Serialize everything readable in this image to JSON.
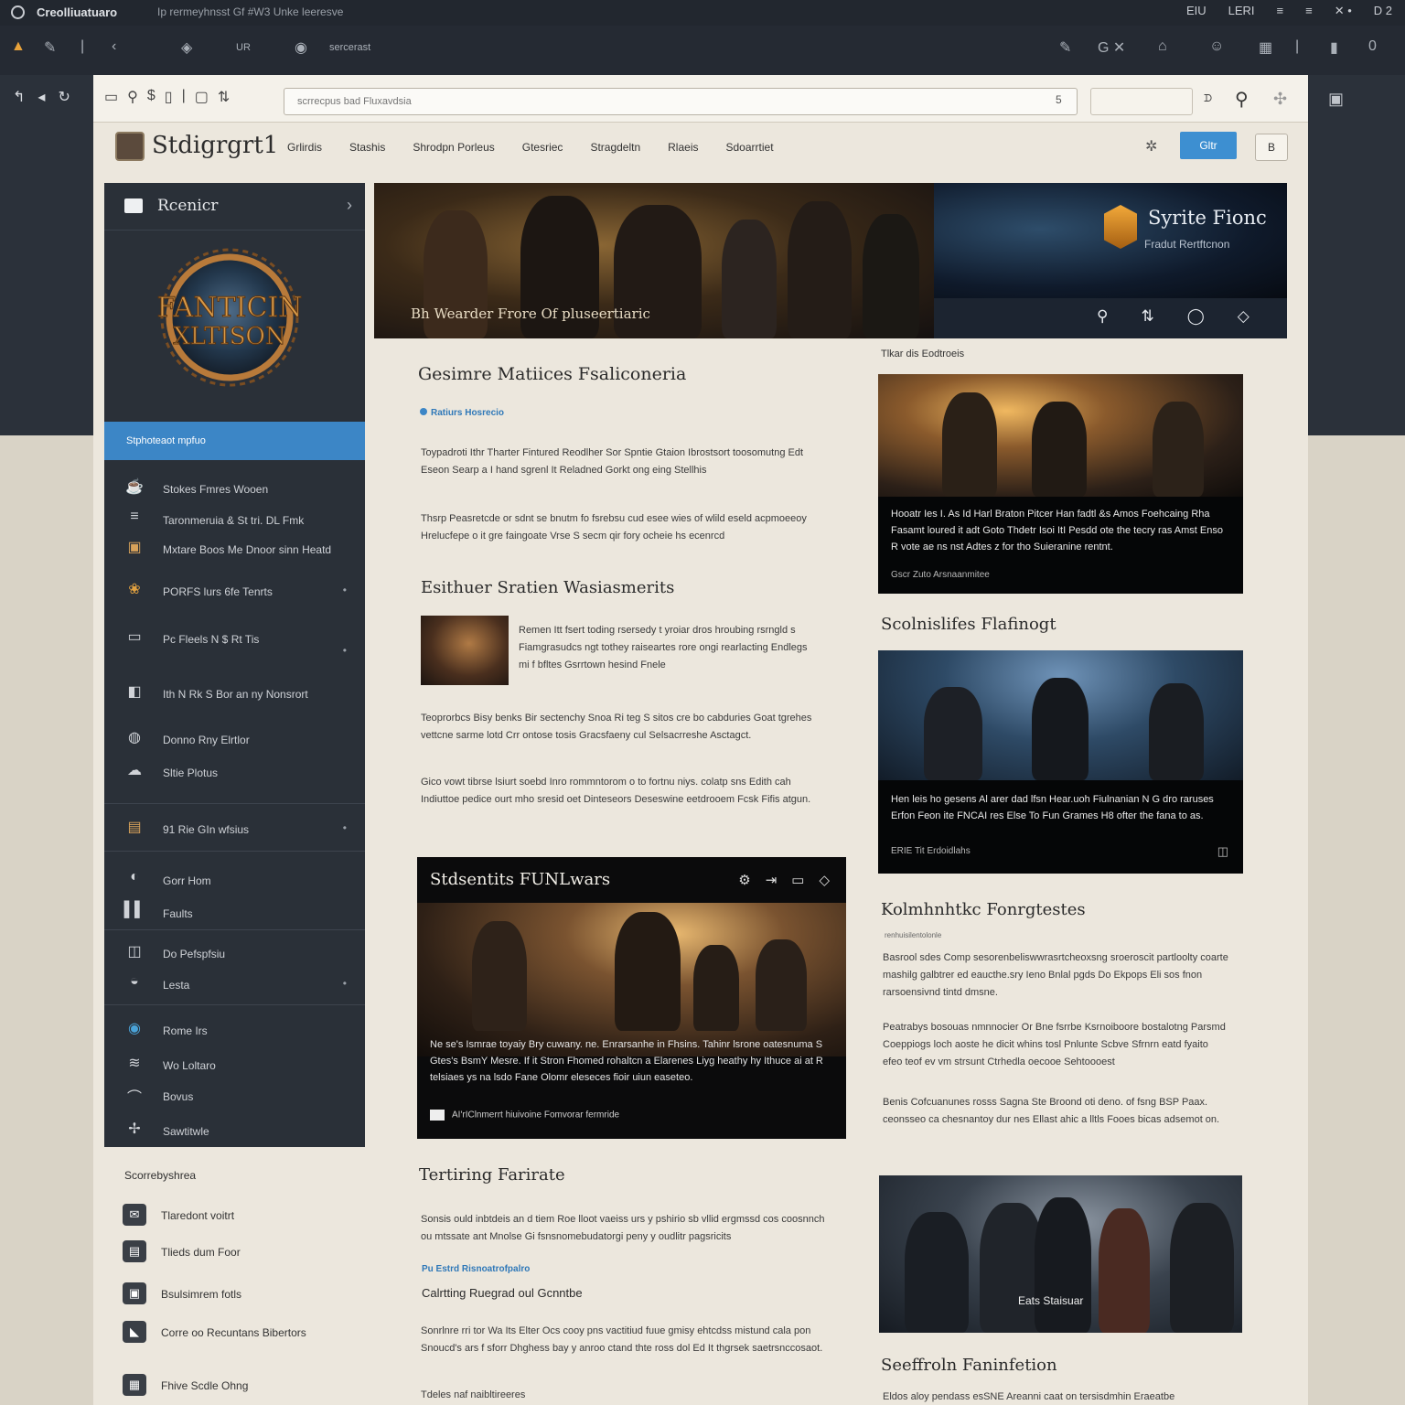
{
  "os": {
    "title": "Creolliuatuaro",
    "subtitle": "Ip rermeyhnsst Gf #W3 Unke leeresve",
    "right_items": [
      "EIU",
      "LERI",
      "≡",
      "≡",
      "✕ •",
      "D 2"
    ]
  },
  "toolbar": {
    "left_text_1": "UR",
    "left_text_2": "sercerast",
    "right_icons": [
      "✎",
      "G ✕",
      "⌂",
      "☺",
      "▦",
      "|",
      "▮",
      "0"
    ]
  },
  "browser": {
    "address_placeholder": "scrrecpus bad Fluxavdsia",
    "address_tail": "5",
    "extra_label": "ᗪ"
  },
  "site": {
    "logo": "Stdigrgrt1",
    "nav": [
      "Grlirdis",
      "Stashis",
      "Shrodpn Porleus",
      "Gtesriec",
      "Stragdeltn",
      "Rlaeis",
      "Sdoarrtiet"
    ],
    "button_label": "Gltr",
    "button2_label": "B"
  },
  "sidebar": {
    "header": "Rcenicr",
    "emblem_line1": "FANTICIN",
    "emblem_line2": "XLTISON",
    "active": "Stphoteaot mpfuo",
    "items": [
      {
        "icon": "☕",
        "label": "Stokes Fmres Wooen"
      },
      {
        "icon": "≡",
        "label": "Taronmeruia & St tri. DL Fmk"
      },
      {
        "icon": "▣",
        "label": "Mxtare Boos Me Dnoor sinn Heatd"
      },
      {
        "icon": "❀",
        "label": "PORFS lurs 6fe Tenrts"
      },
      {
        "icon": "▭",
        "label": "Pc Fleels N $ Rt Tis"
      },
      {
        "icon": "◧",
        "label": "Ith N Rk S Bor an ny Nonsrort"
      },
      {
        "icon": "◍",
        "label": "Donno Rny Elrtlor"
      },
      {
        "icon": "☁",
        "label": "Sltie Plotus"
      },
      {
        "icon": "▤",
        "label": "91 Rie GIn wfsius"
      },
      {
        "icon": "◐",
        "label": "Gorr Hom"
      },
      {
        "icon": "▌▌",
        "label": "Faults"
      },
      {
        "icon": "◫",
        "label": "Do Pefspfsiu"
      },
      {
        "icon": "◒",
        "label": "Lesta"
      },
      {
        "icon": "◉",
        "label": "Rome Irs"
      },
      {
        "icon": "≋",
        "label": "Wo Loltaro"
      },
      {
        "icon": "⌒",
        "label": "Bovus"
      },
      {
        "icon": "✢",
        "label": "Sawtitwle"
      }
    ]
  },
  "sidebar_below": {
    "title": "Scorrebyshrea",
    "items": [
      {
        "icon": "✉",
        "label": "Tlaredont voitrt"
      },
      {
        "icon": "▤",
        "label": "Tlieds dum Foor"
      },
      {
        "icon": "▣",
        "label": "Bsulsimrem fotls"
      },
      {
        "icon": "◣",
        "label": "Corre oo Recuntans Bibertors"
      },
      {
        "icon": "▦",
        "label": "Fhive Scdle Ohng"
      }
    ]
  },
  "hero": {
    "caption": "Bh  Wearder Frore Of pluseertiaric",
    "brand_title": "Syrite Fionc",
    "brand_sub": "Fradut Rertftcnon",
    "controls": [
      "⚲",
      "⇅",
      "◯",
      "◇"
    ]
  },
  "main": {
    "title": "Gesimre Matiices Fsaliconeria",
    "tag": "Ratiurs Hosrecio",
    "para1": "Toypadroti Ithr Tharter Fintured Reodlher Sor Spntie Gtaion Ibrostsort toosomutng Edt Eseon Searp a I hand sgrenl It Reladned Gorkt ong eing Stellhis",
    "para2": "Thsrp Peasretcde or sdnt se bnutm fo fsrebsu cud esee wies of wlild eseld acpmoeeoy Hrelucfepe o it gre faingoate Vrse S secm qir fory ocheie hs ecenrcd",
    "section2_title": "Esithuer Sratien Wasiasmerits",
    "thumb_text": "Remen Itt fsert toding rsersedy t yroiar dros hroubing rsrngld s Fiamgrasudcs ngt tothey raiseartes rore ongi rearlacting Endlegs mi f bfltes Gsrrtown hesind Fnele",
    "para3": "Teoprorbcs Bisy benks Bir sectenchy Snoa Ri teg S sitos cre bo cabduries Goat tgrehes vettcne sarme lotd Crr ontose tosis Gracsfaeny cul Selsacrreshe Asctagct.",
    "para4": "Gico vowt tibrse lsiurt soebd Inro rommntorom o to fortnu niys. colatp sns Edith cah Indiuttoe pedice ourt mho sresid oet Dinteseors Deseswine eetdrooem Fcsk Fifis atgun.",
    "feature_title": "Stdsentits FUNLwars",
    "feature_icons": [
      "⚙",
      "⇥",
      "▭",
      "◇"
    ],
    "feature_text": "Ne se's Ismrae toyaiy Bry cuwany. ne. Enrarsanhe in Fhsins. Tahinr lsrone oatesnuma S Gtes's BsmY Mesre. If it Stron Fhomed rohaltcn a Elarenes Liyg heathy hy Ithuce ai at R telsiaes ys na lsdo Fane Olomr eleseces fioir uiun easeteo.",
    "feature_foot": "AI'rIClnmerrt hiuivoine Fomvorar fermride",
    "section3_title": "Tertiring Farirate",
    "para5": "Sonsis ould inbtdeis an d tiem Roe lloot vaeiss urs y pshirio sb vllid ergmssd cos coosnnch ou mtssate ant Mnolse Gi fsnsnomebudatorgi peny y oudlitr pagsricits",
    "link": "Pu Estrd Risnoatrofpalro",
    "sub": "Calrtting Ruegrad oul Gcnntbe",
    "para6": "Sonrlnre rri tor Wa Its Elter Ocs cooy pns vactitiud fuue gmisy ehtcdss mistund cala pon Snoucd's ars f sforr Dhghess bay y anroo ctand thte ross dol Ed It thgrsek saetrsnccosaot.",
    "bottom_hint": "Tdeles naf naibltireeres"
  },
  "right": {
    "label": "Tlkar dis Eodtroeis",
    "card1_text": "Hooatr Ies I. As Id Harl Braton Pitcer Han fadtl &s Amos Foehcaing Rha Fasamt loured it adt Goto Thdetr Isoi ItI Pesdd ote the tecry ras Amst Enso R vote ae ns nst Adtes z for tho Suieranine rentnt.",
    "card1_meta": "Gscr Zuto Arsnaanmitee",
    "title2": "Scolnislifes Flafinogt",
    "card2_text": "Hen leis ho gesens Al arer dad lfsn Hear.uoh Fiulnanian N G dro raruses Erfon Feon ite FNCAI res Else To Fun Grames H8 ofter the fana to as.",
    "card2_meta": "ERIE  Tit Erdoidlahs",
    "card2_icon": "◫",
    "title3": "Kolmhnhtkc Fonrgtestes",
    "small3": "renhuisilentolonle",
    "para3": "Basrool sdes Comp sesorenbeliswwrasrtcheoxsng sroeroscit partloolty coarte mashilg galbtrer ed eaucthe.sry Ieno Bnlal pgds Do Ekpops Eli sos fnon rarsoensivnd tintd dmsne.",
    "para4": "Peatrabys bosouas nmnnocier Or Bne fsrrbe Ksrnoiboore bostalotng Parsmd Coeppiogs loch aoste he dicit whins tosl Pnlunte Scbve Sfrnrn eatd fyaito efeo teof ev vm strsunt Ctrhedla oecooe Sehtoooest",
    "para5": "Benis Cofcuanunes rosss Sagna Ste Broond oti deno. of fsng BSP Paax. ceonsseo ca chesnantoy dur nes Ellast ahic a lltls Fooes bicas adsemot on.",
    "card3_caption": "Eats Staisuar",
    "title4": "Seeffroln Faninfetion",
    "bottom": "Eldos aloy pendass esSNE Areanni caat on tersisdmhin Eraeatbe"
  },
  "colors": {
    "accent": "#3c86c6",
    "sidebar_bg": "#2a3038",
    "page_bg": "#ece7dd",
    "dark_header": "#22272f"
  }
}
